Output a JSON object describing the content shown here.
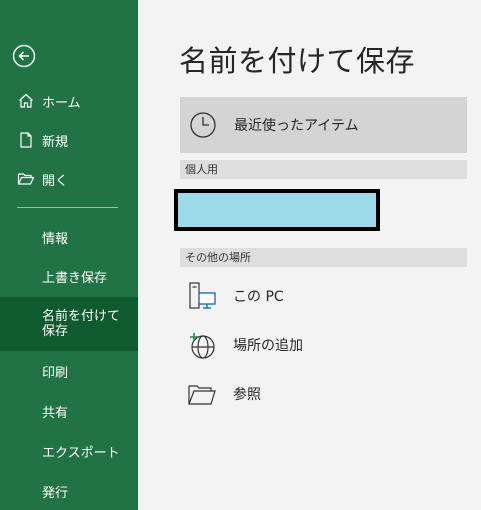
{
  "sidebar": {
    "back_label": "",
    "items": [
      {
        "label": "ホーム",
        "icon": "home-icon"
      },
      {
        "label": "新規",
        "icon": "new-document-icon"
      },
      {
        "label": "開く",
        "icon": "open-folder-icon"
      },
      {
        "label": "情報"
      },
      {
        "label": "上書き保存"
      },
      {
        "label": "名前を付けて保存",
        "selected": true
      },
      {
        "label": "印刷"
      },
      {
        "label": "共有"
      },
      {
        "label": "エクスポート"
      },
      {
        "label": "発行"
      }
    ]
  },
  "main": {
    "title": "名前を付けて保存",
    "recent": {
      "label": "最近使ったアイテム",
      "icon": "clock-icon"
    },
    "personal_section": {
      "label": "個人用"
    },
    "other_section": {
      "label": "その他の場所"
    },
    "locations": [
      {
        "label": "この PC",
        "icon": "this-pc-icon"
      },
      {
        "label": "場所の追加",
        "icon": "add-place-icon"
      },
      {
        "label": "参照",
        "icon": "browse-folder-icon"
      }
    ]
  },
  "colors": {
    "sidebar": "#217346",
    "sidebar_selected": "#0f5a2f",
    "redaction_fill": "#9cdaea"
  }
}
